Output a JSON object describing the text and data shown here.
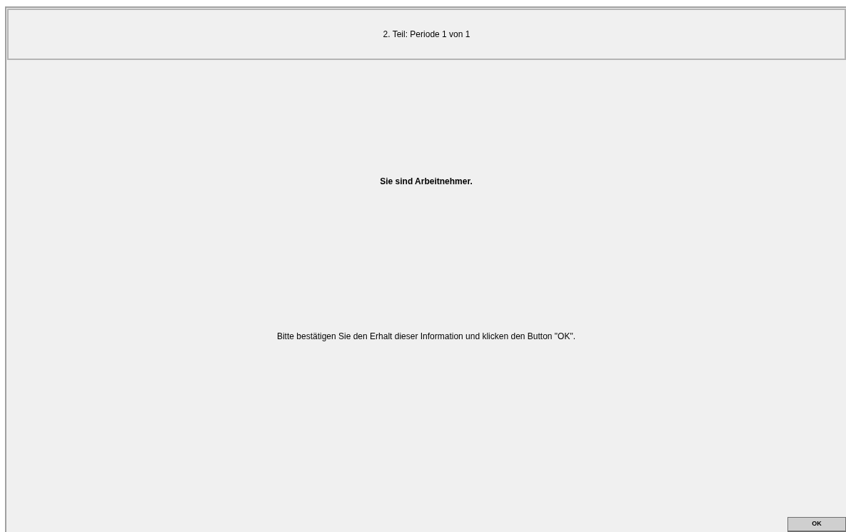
{
  "header": {
    "title": "2. Teil: Periode 1 von 1"
  },
  "role_message": "Sie sind Arbeitnehmer.",
  "instruction": "Bitte bestätigen Sie den Erhalt dieser Information und klicken den Button \"OK\".",
  "buttons": [
    "OK"
  ]
}
